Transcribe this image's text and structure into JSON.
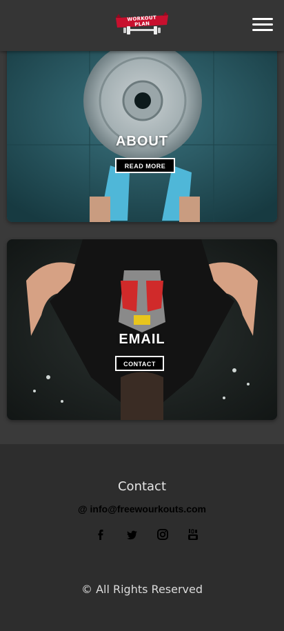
{
  "header": {
    "logo_text": "WORKOUT PLAN",
    "menu_icon": "hamburger-menu-icon"
  },
  "cards": [
    {
      "title": "ABOUT",
      "button": "READ MORE"
    },
    {
      "title": "EMAIL",
      "button": "CONTACT"
    }
  ],
  "footer": {
    "title": "Contact",
    "email": "@ info@freewourkouts.com",
    "socials": [
      "facebook-icon",
      "twitter-icon",
      "instagram-icon",
      "youtube-icon"
    ],
    "copyright": "© All Rights Reserved"
  },
  "colors": {
    "header_bg": "#353535",
    "footer_bg": "#2d2d2d",
    "logo_red": "#c8102e"
  }
}
